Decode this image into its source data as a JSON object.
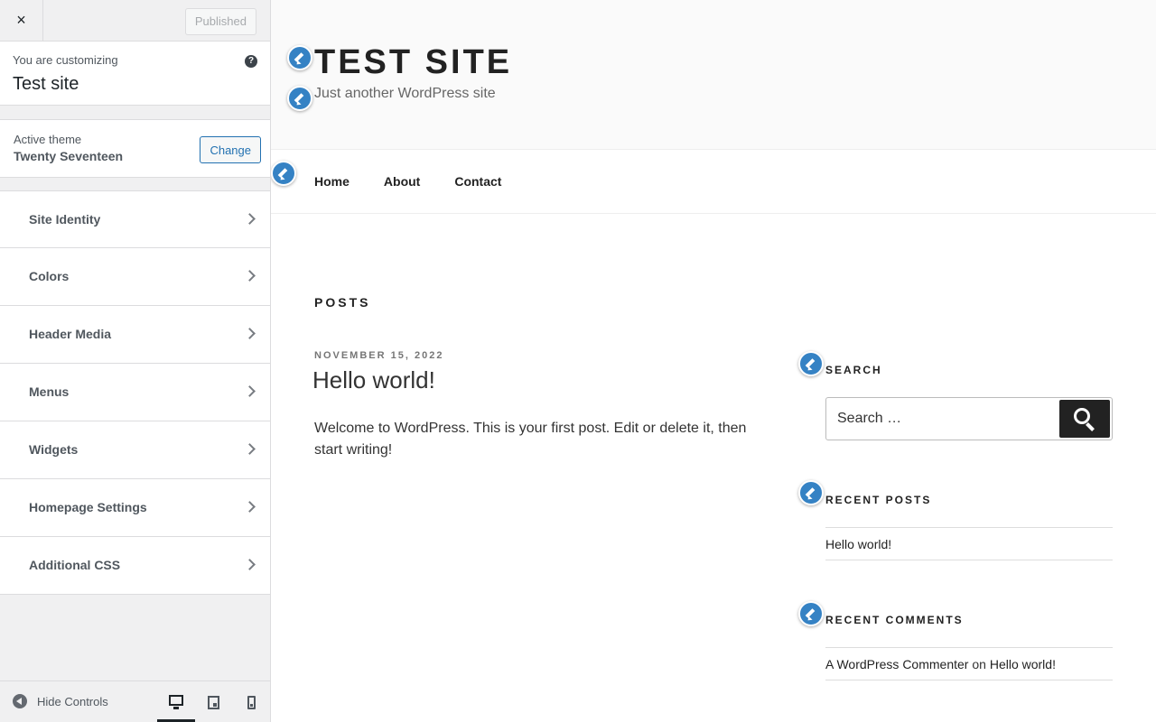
{
  "sidebar": {
    "close_icon": "×",
    "published_label": "Published",
    "customizing_label": "You are customizing",
    "site_title": "Test site",
    "help_icon": "?",
    "active_theme_label": "Active theme",
    "theme_name": "Twenty Seventeen",
    "change_label": "Change",
    "sections": [
      {
        "label": "Site Identity"
      },
      {
        "label": "Colors"
      },
      {
        "label": "Header Media"
      },
      {
        "label": "Menus"
      },
      {
        "label": "Widgets"
      },
      {
        "label": "Homepage Settings"
      },
      {
        "label": "Additional CSS"
      }
    ],
    "hide_controls_label": "Hide Controls",
    "devices": [
      "desktop",
      "tablet",
      "mobile"
    ],
    "active_device": "desktop"
  },
  "preview": {
    "site_name": "TEST SITE",
    "site_description": "Just another WordPress site",
    "nav": [
      "Home",
      "About",
      "Contact"
    ],
    "posts_heading": "POSTS",
    "post": {
      "date": "NOVEMBER 15, 2022",
      "title": "Hello world!",
      "excerpt": "Welcome to WordPress. This is your first post. Edit or delete it, then start writing!"
    },
    "widgets": {
      "search_title": "SEARCH",
      "search_placeholder": "Search …",
      "recent_posts_title": "RECENT POSTS",
      "recent_posts": [
        "Hello world!"
      ],
      "recent_comments_title": "RECENT COMMENTS",
      "comment_author": "A WordPress Commenter",
      "comment_on": "on",
      "comment_post": "Hello world!"
    }
  },
  "colors": {
    "accent": "#2271b1",
    "edit_shortcut": "#3582c4"
  }
}
